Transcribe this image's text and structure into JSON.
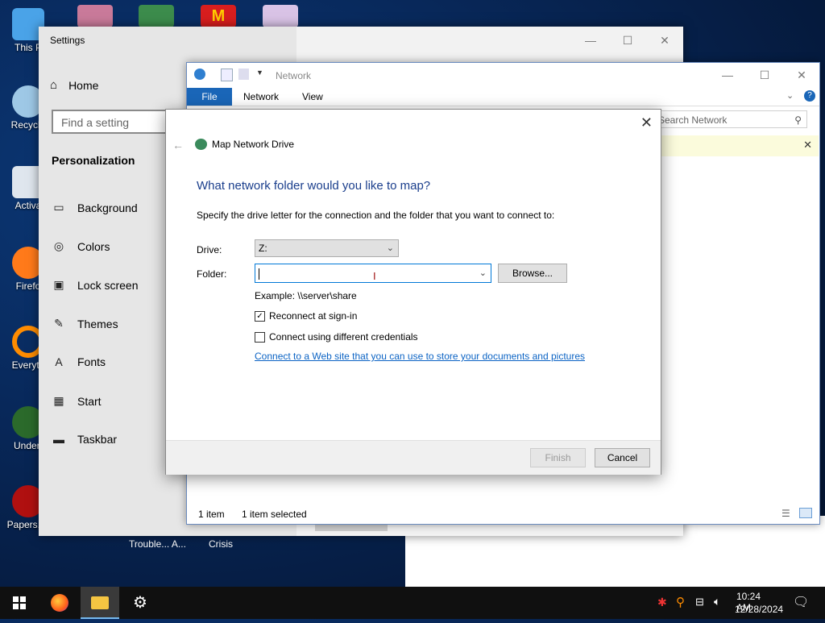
{
  "desktop": {
    "icons": [
      {
        "label": "This P",
        "color": "#4aa3e8"
      },
      {
        "label": "Recycle",
        "color": "#9ec8e6"
      },
      {
        "label": "Activa",
        "color": "#dfe6ee"
      },
      {
        "label": "Firefo",
        "color": "#ff7a1a"
      },
      {
        "label": "Everyth",
        "color": "#ff8c00"
      },
      {
        "label": "Undert",
        "color": "#2b6a2b"
      },
      {
        "label": "Papers, P",
        "color": "#b01010"
      }
    ],
    "bottom_labels": [
      "Trouble... A...",
      "Crisis"
    ]
  },
  "settings": {
    "title": "Settings",
    "home": "Home",
    "search_placeholder": "Find a setting",
    "section": "Personalization",
    "items": [
      {
        "label": "Background",
        "icon": "picture-icon",
        "glyph": "▭"
      },
      {
        "label": "Colors",
        "icon": "palette-icon",
        "glyph": "◎"
      },
      {
        "label": "Lock screen",
        "icon": "lock-screen-icon",
        "glyph": "▣"
      },
      {
        "label": "Themes",
        "icon": "brush-icon",
        "glyph": "✎"
      },
      {
        "label": "Fonts",
        "icon": "font-icon",
        "glyph": "A"
      },
      {
        "label": "Start",
        "icon": "start-icon",
        "glyph": "▦"
      },
      {
        "label": "Taskbar",
        "icon": "taskbar-icon",
        "glyph": "▬"
      }
    ]
  },
  "explorer": {
    "title": "Network",
    "tabs": [
      "File",
      "Network",
      "View"
    ],
    "search_placeholder": "Search Network",
    "status_items": "1 item",
    "status_selected": "1 item selected"
  },
  "dialog": {
    "title": "Map Network Drive",
    "heading": "What network folder would you like to map?",
    "description": "Specify the drive letter for the connection and the folder that you want to connect to:",
    "drive_label": "Drive:",
    "drive_value": "Z:",
    "folder_label": "Folder:",
    "folder_value": "",
    "browse_label": "Browse...",
    "example": "Example: \\\\server\\share",
    "reconnect_label": "Reconnect at sign-in",
    "reconnect_checked": true,
    "credentials_label": "Connect using different credentials",
    "credentials_checked": false,
    "link_text": "Connect to a Web site that you can use to store your documents and pictures",
    "finish_label": "Finish",
    "cancel_label": "Cancel"
  },
  "taskbar": {
    "time": "10:24 AM",
    "date": "12/28/2024"
  },
  "colors": {
    "accent": "#0078d7",
    "heading": "#1a3e8c",
    "link": "#0b63c4"
  }
}
